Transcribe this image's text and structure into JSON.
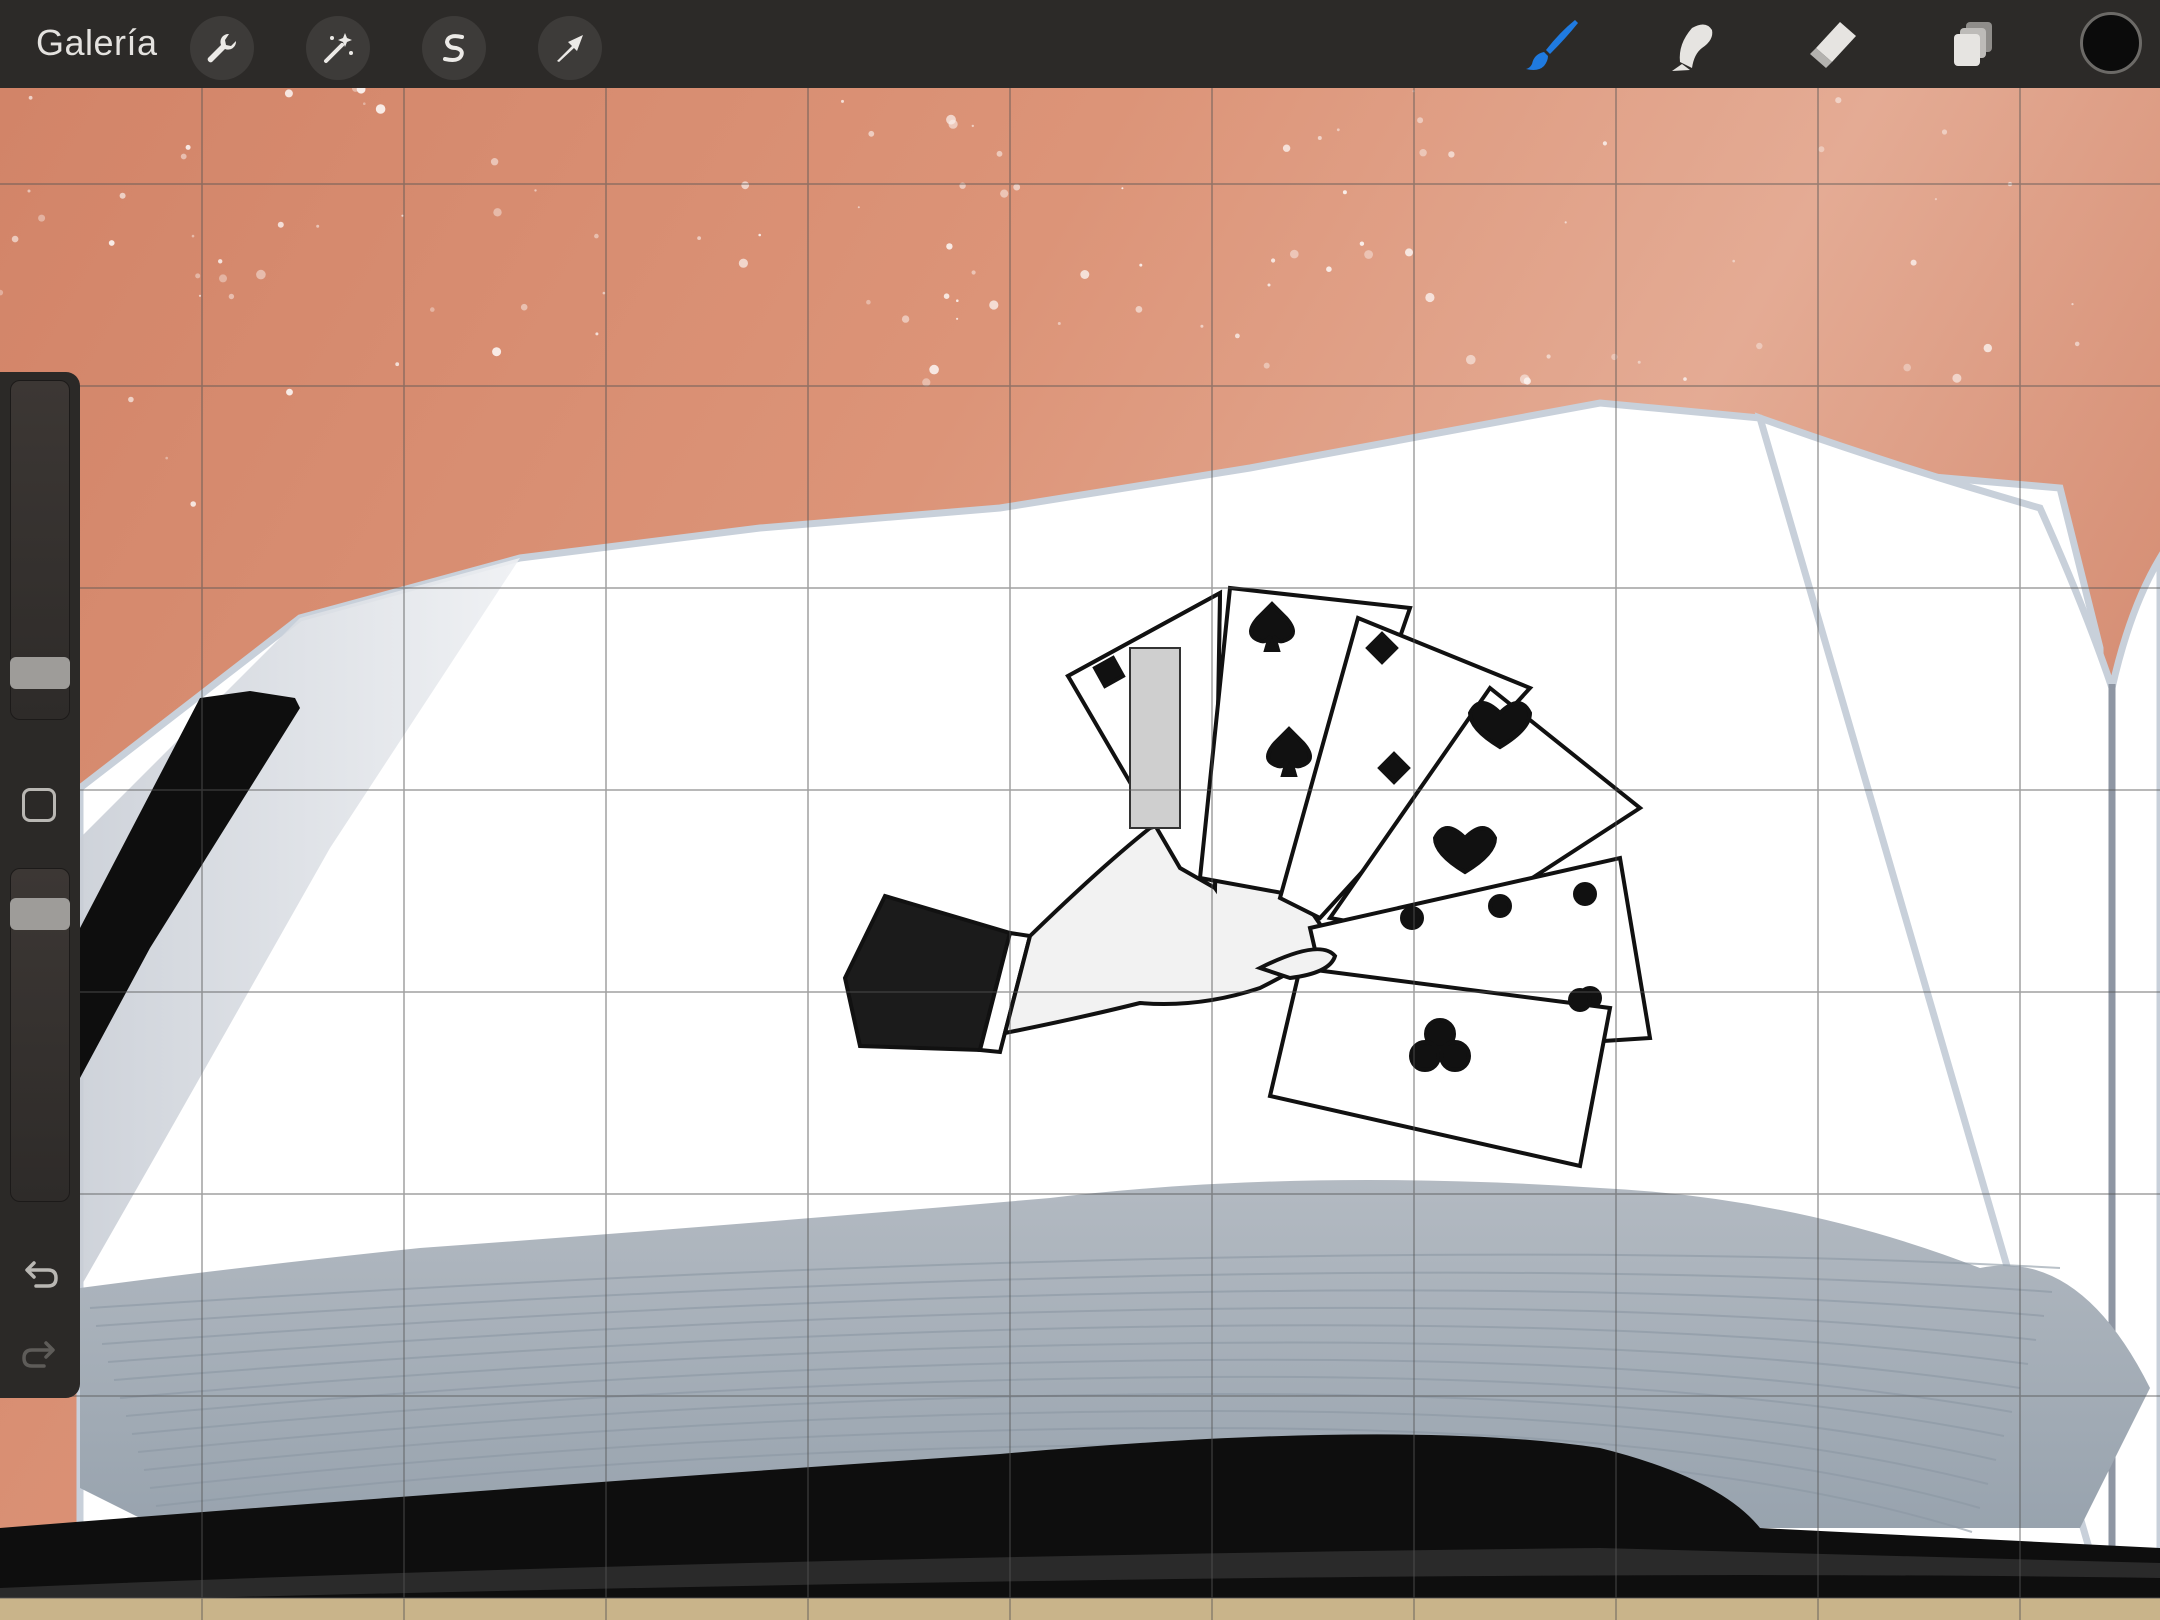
{
  "app": {
    "gallery_label": "Galería"
  },
  "toolbar": {
    "left_tools": [
      {
        "name": "actions",
        "icon": "wrench-icon"
      },
      {
        "name": "adjustments",
        "icon": "magic-wand-icon"
      },
      {
        "name": "selection",
        "icon": "selection-s-icon"
      },
      {
        "name": "transform",
        "icon": "arrow-cursor-icon"
      }
    ],
    "right_tools": [
      {
        "name": "brush",
        "icon": "brush-icon",
        "active": true
      },
      {
        "name": "smudge",
        "icon": "smudge-finger-icon",
        "active": false
      },
      {
        "name": "eraser",
        "icon": "eraser-icon",
        "active": false
      },
      {
        "name": "layers",
        "icon": "layers-icon",
        "active": false
      }
    ],
    "current_color": "#0b0b0b",
    "active_color": "#1f7ae0"
  },
  "sidebar": {
    "brush_size_level": 0.1,
    "opacity_level": 0.9,
    "undo_icon": "undo-arrow-icon",
    "redo_icon": "redo-arrow-icon"
  },
  "canvas": {
    "grid_visible": true,
    "sky_color": "#d98a6e",
    "page_color": "#ffffff",
    "page_edge_color": "#a9b1ba",
    "cover_color": "#0e0e0e"
  }
}
